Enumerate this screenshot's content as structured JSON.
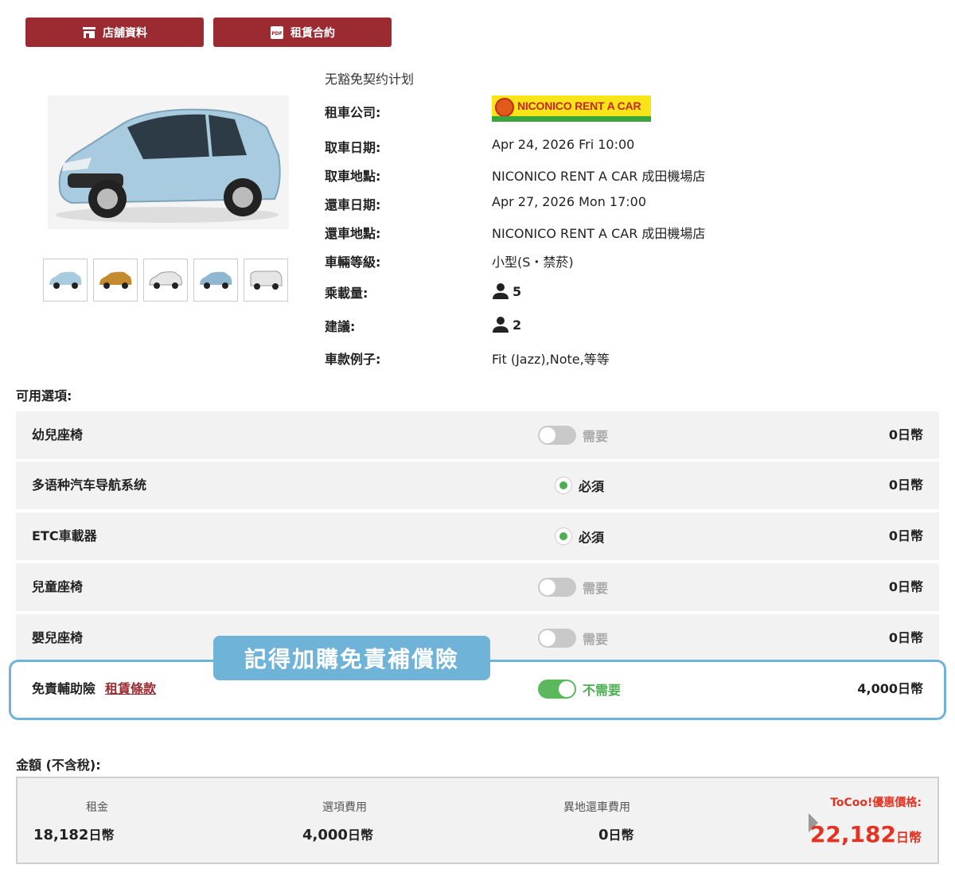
{
  "buttons": {
    "store_info": "店舖資料",
    "contract": "租賃合約"
  },
  "car": {
    "plan": "无豁免契约计划",
    "company_label": "租車公司:",
    "company_logo_text": "NICONICO RENT A CAR",
    "pickup_date_label": "取車日期:",
    "pickup_date": "Apr 24, 2026 Fri 10:00",
    "pickup_place_label": "取車地點:",
    "pickup_place": "NICONICO RENT A CAR 成田機場店",
    "return_date_label": "還車日期:",
    "return_date": "Apr 27, 2026 Mon 17:00",
    "return_place_label": "還車地點:",
    "return_place": "NICONICO RENT A CAR 成田機場店",
    "class_label": "車輛等級:",
    "class": "小型(S・禁菸)",
    "capacity_label": "乘載量:",
    "capacity": "5",
    "recommended_label": "建議:",
    "recommended": "2",
    "models_label": "車款例子:",
    "models": "Fit (Jazz),Note,等等"
  },
  "options": {
    "title": "可用選項:",
    "items": [
      {
        "name": "幼兒座椅",
        "state": "需要",
        "price": "0日幣"
      },
      {
        "name": "多语种汽车导航系统",
        "state": "必須",
        "price": "0日幣"
      },
      {
        "name": "ETC車載器",
        "state": "必須",
        "price": "0日幣"
      },
      {
        "name": "兒童座椅",
        "state": "需要",
        "price": "0日幣"
      },
      {
        "name": "嬰兒座椅",
        "state": "需要",
        "price": "0日幣"
      },
      {
        "name": "免責輔助險",
        "link": "租賃條款",
        "state": "不需要",
        "price": "4,000日幣"
      }
    ]
  },
  "callout": "記得加購免責補償險",
  "summary": {
    "title": "金額 (不含稅):",
    "rent_label": "租金",
    "rent": "18,182",
    "options_label": "選項費用",
    "options": "4,000",
    "dropoff_label": "異地還車費用",
    "dropoff": "0",
    "unit": "日幣",
    "tocoo_label": "ToCoo!優惠價格:",
    "tocoo": "22,182"
  },
  "colors": {
    "brand": "#9c2a31",
    "accent_green": "#5cb85c",
    "price_red": "#e53222",
    "highlight_blue": "#6fb3d8"
  }
}
